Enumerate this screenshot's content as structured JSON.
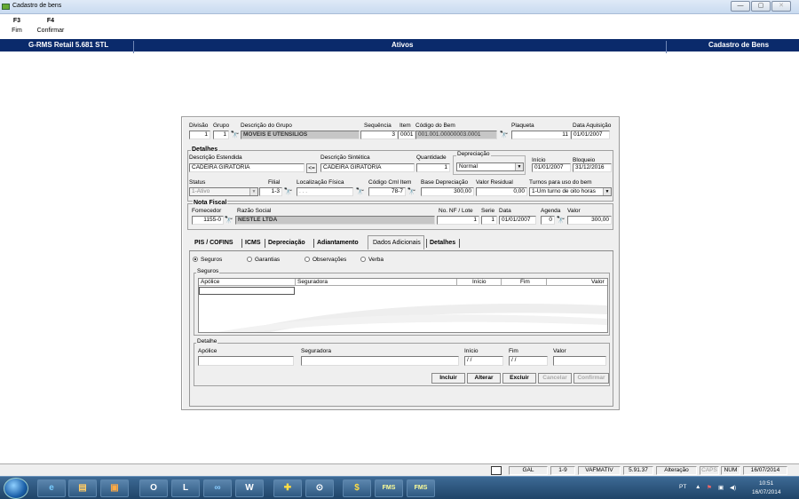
{
  "window": {
    "title": "Cadastro de bens",
    "min": "—",
    "max": "▢",
    "close": "✕"
  },
  "toolbar": [
    {
      "key": "F3",
      "label": "Fim"
    },
    {
      "key": "F4",
      "label": "Confirmar"
    }
  ],
  "header": {
    "left": "G-RMS Retail 5.681 STL",
    "center": "Ativos",
    "right": "Cadastro de Bens"
  },
  "form": {
    "divisao_label": "Divisão",
    "divisao": "1",
    "grupo_label": "Grupo",
    "grupo": "1",
    "desc_grupo_label": "Descrição do Grupo",
    "desc_grupo": "MOVEIS E UTENSILIOS",
    "sequencia_label": "Sequência",
    "sequencia": "3",
    "item_label": "Item",
    "item": "0001",
    "codigo_bem_label": "Código do Bem",
    "codigo_bem": "001.001.00000003.0001",
    "plaqueta_label": "Plaqueta",
    "plaqueta": "11",
    "data_aquisicao_label": "Data Aquisição",
    "data_aquisicao": "01/01/2007",
    "detalhes_label": "Detalhes",
    "desc_estendida_label": "Descrição Estendida",
    "desc_estendida": "CADEIRA GIRATORIA",
    "copy_btn": "<=",
    "desc_sintetica_label": "Descrição Sintética",
    "desc_sintetica": "CADEIRA GIRATORIA",
    "quantidade_label": "Quantidade",
    "quantidade": "1",
    "depreciacao_label": "Depreciação",
    "depreciacao": "Normal",
    "inicio_label": "Início",
    "inicio": "01/01/2007",
    "bloqueio_label": "Bloqueio",
    "bloqueio": "31/12/2016",
    "status_label": "Status",
    "status": "1-Ativo",
    "filial_label": "Filial",
    "filial": "1-3",
    "localizacao_label": "Localização Física",
    "localizacao": "  .  .  .  ",
    "codigo_cml_label": "Código Cml Item",
    "codigo_cml": "78-7",
    "base_dep_label": "Base Depreciação",
    "base_dep": "300,00",
    "valor_residual_label": "Valor Residual",
    "valor_residual": "0,00",
    "turnos_label": "Turnos para uso do bem",
    "turnos": "1-Um turno de oito horas",
    "nota_fiscal_label": "Nota Fiscal",
    "fornecedor_label": "Fornecedor",
    "fornecedor": "1155-0",
    "razao_social_label": "Razão Social",
    "razao_social": "NESTLE LTDA",
    "nf_lote_label": "No. NF / Lote",
    "nf_lote": "1",
    "serie_label": "Serie",
    "serie": "1",
    "data_label": "Data",
    "data": "01/01/2007",
    "agenda_label": "Agenda",
    "agenda": "0",
    "valor_label": "Valor",
    "valor": "300,00"
  },
  "tabs": [
    "PIS / COFINS",
    "ICMS",
    "Depreciação",
    "Adiantamento",
    "Dados Adicionais",
    "Detalhes"
  ],
  "radios": [
    {
      "label": "Seguros",
      "checked": true
    },
    {
      "label": "Garantias",
      "checked": false
    },
    {
      "label": "Observações",
      "checked": false
    },
    {
      "label": "Verba",
      "checked": false
    }
  ],
  "seguros": {
    "title": "Seguros",
    "columns": [
      "Apólice",
      "Seguradora",
      "Início",
      "Fim",
      "Valor"
    ]
  },
  "detalhe": {
    "title": "Detalhe",
    "apolice_label": "Apólice",
    "seguradora_label": "Seguradora",
    "inicio_label": "Início",
    "inicio": " / / ",
    "fim_label": "Fim",
    "fim": " / / ",
    "valor_label": "Valor"
  },
  "buttons": {
    "incluir": "Incluir",
    "alterar": "Alterar",
    "excluir": "Excluir",
    "cancelar": "Cancelar",
    "confirmar": "Confirmar"
  },
  "statusbar": [
    "GAL",
    "1-9",
    "VAFMATIV",
    "5.91.37",
    "Alteração",
    "CAPS",
    "NUM",
    "16/07/2014"
  ],
  "taskbar": {
    "apps": [
      "e",
      "▤",
      "▣",
      "O",
      "L",
      "∞",
      "W",
      "✚",
      "⊙",
      "$",
      "FMS",
      "FMS"
    ],
    "lang": "PT",
    "time": "10:51",
    "date": "16/07/2014"
  }
}
